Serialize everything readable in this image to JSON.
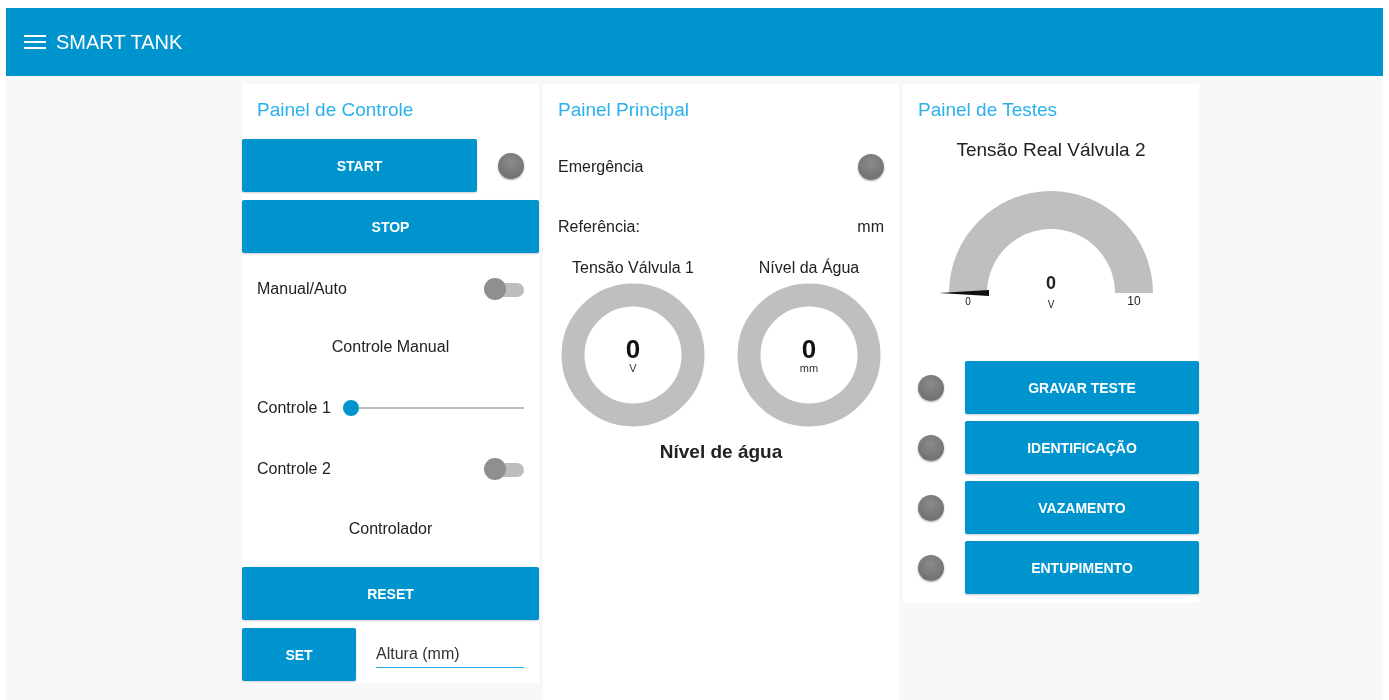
{
  "header": {
    "title": "SMART TANK"
  },
  "control_panel": {
    "title": "Painel de Controle",
    "start": {
      "label": "START",
      "led_on": false
    },
    "stop": {
      "label": "STOP"
    },
    "manual_auto": {
      "label": "Manual/Auto",
      "on": false
    },
    "manual_section": "Controle Manual",
    "control_1": {
      "label": "Controle 1",
      "level": 0
    },
    "control_2": {
      "label": "Controle 2",
      "on": false
    },
    "controller_section": "Controlador",
    "reset": {
      "label": "RESET"
    },
    "set": {
      "label": "SET",
      "placeholder": "Altura (mm)"
    }
  },
  "main_panel": {
    "title": "Painel Principal",
    "emergency": {
      "label": "Emergência",
      "led_on": false
    },
    "reference": {
      "label": "Referência:",
      "value": "mm"
    },
    "gauges": [
      {
        "label": "Tensão Válvula 1",
        "value": "0",
        "unit": "V"
      },
      {
        "label": "Nível da Água",
        "value": "0",
        "unit": "mm"
      }
    ],
    "caption": "Nível de água"
  },
  "test_panel": {
    "title": "Painel de Testes",
    "gauge": {
      "title": "Tensão Real Válvula 2",
      "value": "0",
      "unit": "V",
      "min": "0",
      "max": "10",
      "level": 0
    },
    "tests": [
      {
        "label": "GRAVAR TESTE",
        "led_on": false
      },
      {
        "label": "IDENTIFICAÇÃO",
        "led_on": false
      },
      {
        "label": "VAZAMENTO",
        "led_on": false
      },
      {
        "label": "ENTUPIMENTO",
        "led_on": false
      }
    ]
  }
}
